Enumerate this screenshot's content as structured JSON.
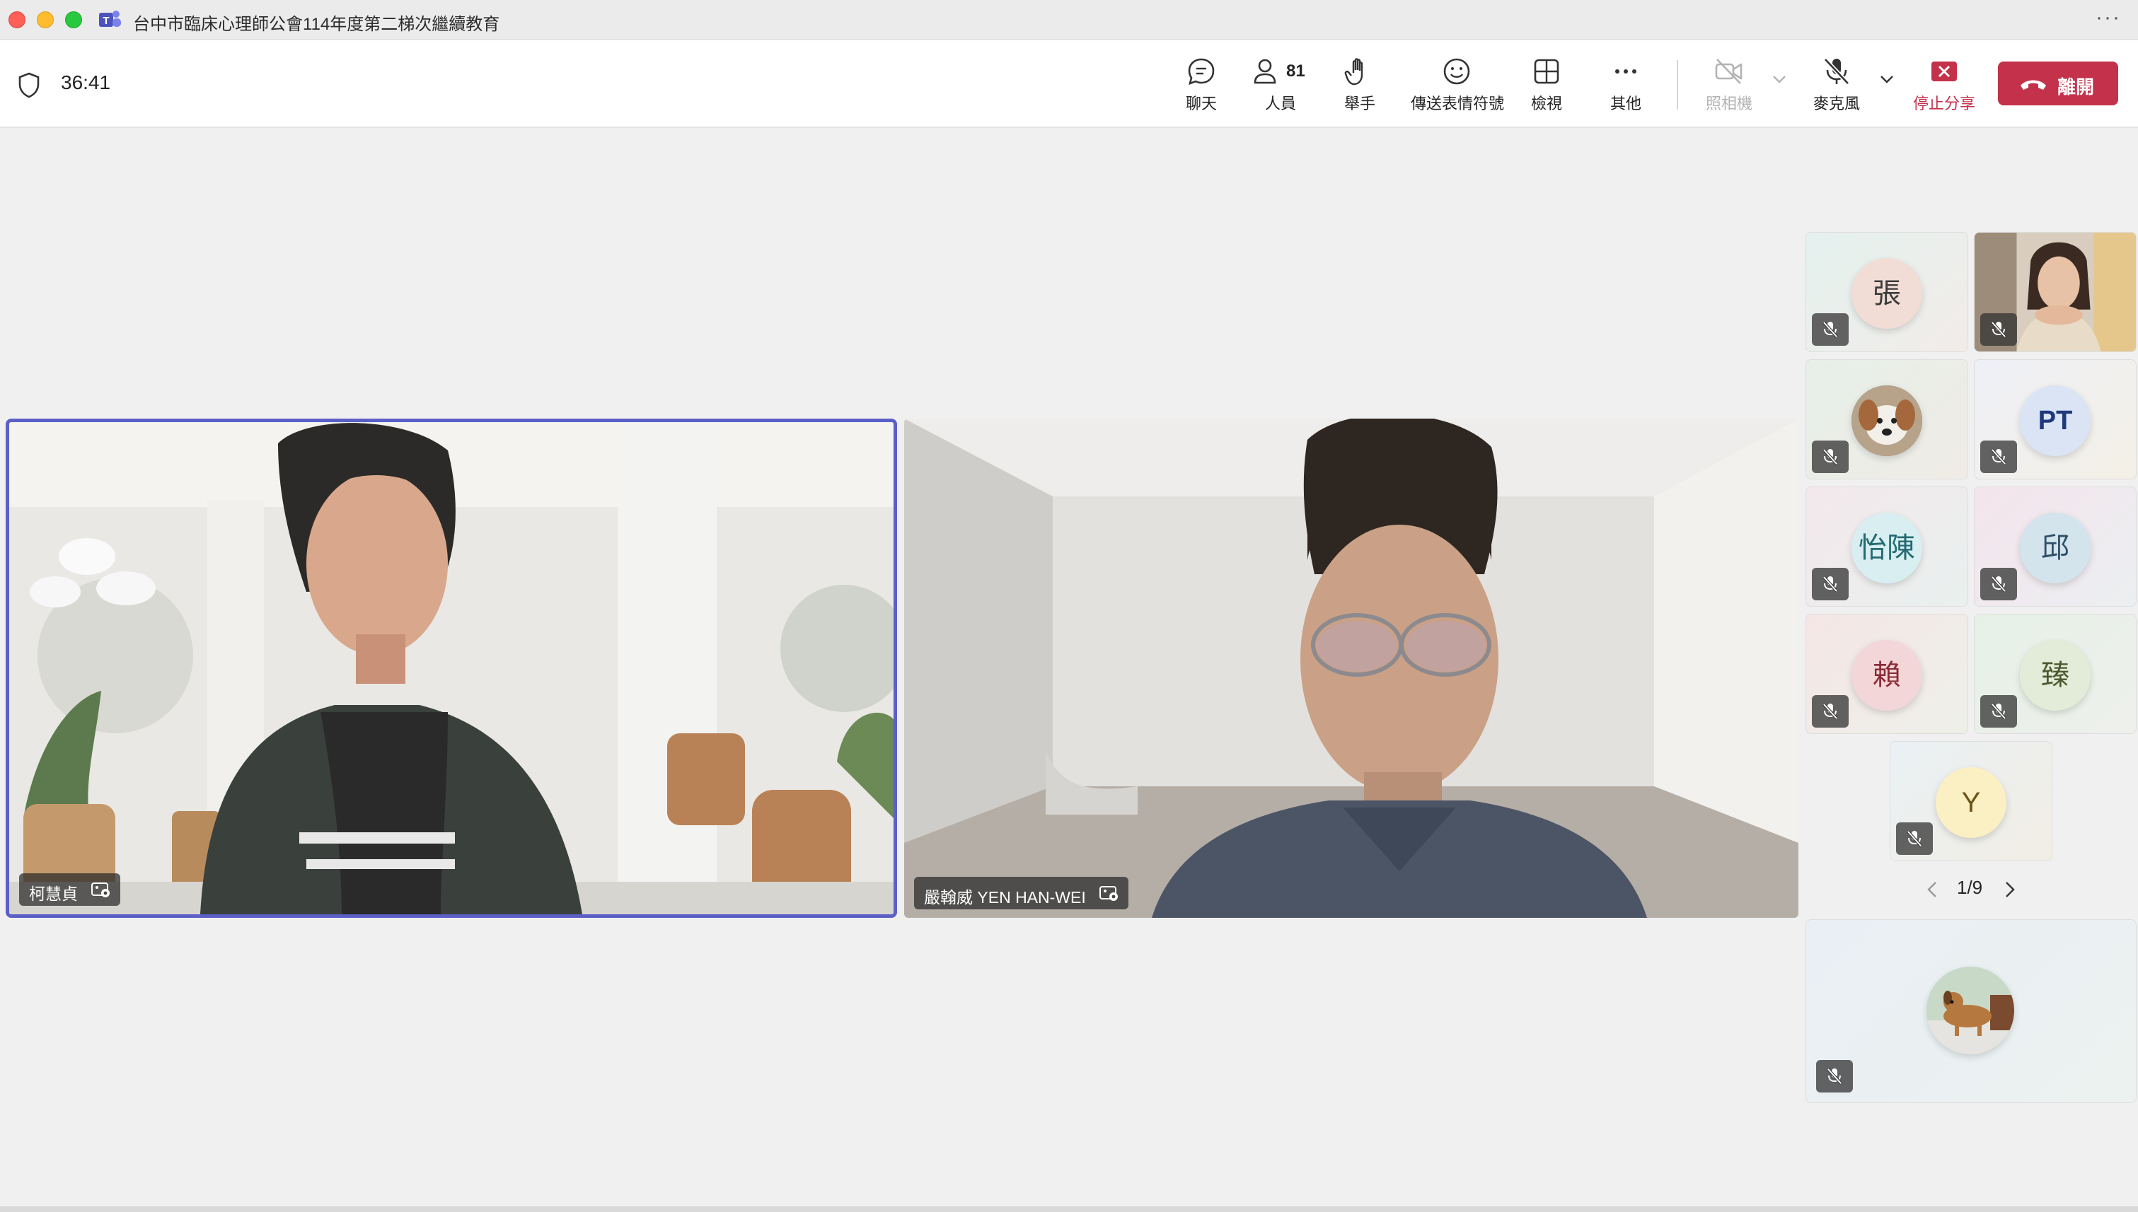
{
  "window": {
    "title": "台中市臨床心理師公會114年度第二梯次繼續教育",
    "more": "···"
  },
  "toolbar": {
    "timer": "36:41",
    "chat_label": "聊天",
    "people_label": "人員",
    "people_count": "81",
    "raise_hand_label": "舉手",
    "react_label": "傳送表情符號",
    "view_label": "檢視",
    "more_label": "其他",
    "camera_label": "照相機",
    "mic_label": "麥克風",
    "stop_share_label": "停止分享",
    "leave_label": "離開",
    "colors": {
      "leave": "#c4314b",
      "active_border": "#5b5fc7"
    }
  },
  "stage": {
    "participants": [
      {
        "name": "柯慧貞",
        "icon": "background-effects-icon",
        "active_speaker": true
      },
      {
        "name": "嚴翰威 YEN HAN-WEI",
        "icon": "background-effects-icon",
        "active_speaker": false
      }
    ]
  },
  "gallery": {
    "tiles": [
      {
        "initials": "張",
        "kind": "initials",
        "muted": true
      },
      {
        "initials": "",
        "kind": "video",
        "muted": true
      },
      {
        "initials": "",
        "kind": "dog-photo",
        "muted": true
      },
      {
        "initials": "PT",
        "kind": "initials",
        "muted": true
      },
      {
        "initials": "怡陳",
        "kind": "initials",
        "muted": true
      },
      {
        "initials": "邱",
        "kind": "initials",
        "muted": true
      },
      {
        "initials": "賴",
        "kind": "initials",
        "muted": true
      },
      {
        "initials": "臻",
        "kind": "initials",
        "muted": true
      },
      {
        "initials": "Y",
        "kind": "initials",
        "muted": true
      }
    ],
    "pager": "1/9",
    "self_tile": {
      "kind": "dog-photo",
      "muted": true
    }
  }
}
